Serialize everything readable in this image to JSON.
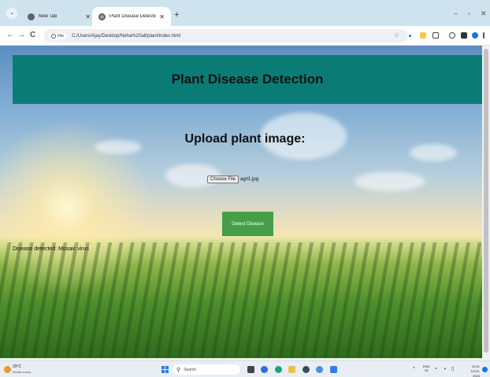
{
  "browser": {
    "tabs": [
      {
        "title": "New Tab",
        "active": false
      },
      {
        "title": "Plant Disease Detection",
        "active": true
      }
    ],
    "new_tab_glyph": "+",
    "window_controls": [
      "–",
      "▫",
      "✕"
    ],
    "nav": {
      "back": "←",
      "forward": "→",
      "reload": "C"
    },
    "address": {
      "scheme_chip": "File",
      "url": "C:/Users/Ajay/Desktop/Neha%20all/plant/index.html"
    },
    "bookmark_icon": "star-icon"
  },
  "page": {
    "header_title": "Plant Disease Detection",
    "upload_title": "Upload plant image:",
    "file_input": {
      "button_label": "Choose File",
      "file_name": "agri1.jpg"
    },
    "detect_button_label": "Detect Disease",
    "result_text": "Disease detected: Mosaic virus",
    "colors": {
      "header_bg": "#0b7b75",
      "detect_button_bg": "#43a047"
    }
  },
  "taskbar": {
    "weather": {
      "temp": "29°C",
      "desc": "Mostly sunny"
    },
    "search_placeholder": "Search",
    "lang": {
      "line1": "ENG",
      "line2": "IN"
    },
    "clock": {
      "time": "20:21",
      "date": "13-03-2024"
    }
  }
}
